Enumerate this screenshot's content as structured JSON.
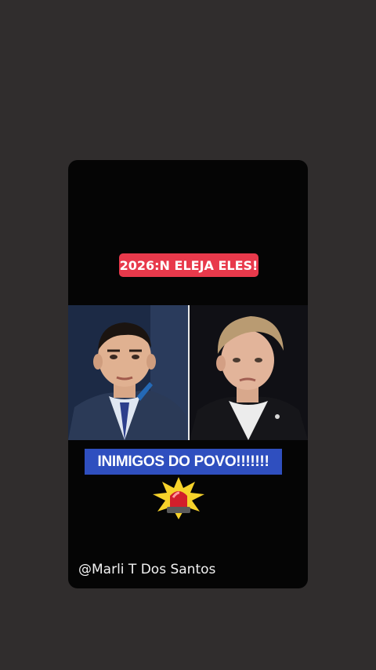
{
  "story": {
    "headline": "2026:N ELEJA ELES!",
    "banner": "INIMIGOS DO POVO!!!!!!!",
    "credit": "@Marli T Dos Santos",
    "siren_icon": "siren-icon",
    "colors": {
      "background": "#302d2d",
      "card": "#050505",
      "headline_bg": "#e8394b",
      "banner_bg": "#2f4fbf"
    }
  }
}
